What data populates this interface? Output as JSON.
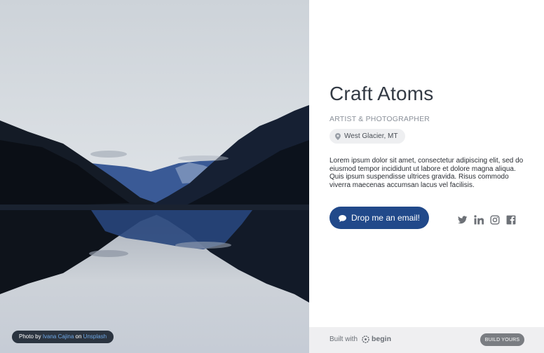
{
  "profile": {
    "name": "Craft Atoms",
    "role": "ARTIST & PHOTOGRAPHER",
    "location": "West Glacier, MT",
    "bio": "Lorem ipsum dolor sit amet, consectetur adipiscing elit, sed do eiusmod tempor incididunt ut labore et dolore magna aliqua. Quis ipsum suspendisse ultrices gravida. Risus commodo viverra maecenas accumsan lacus vel facilisis.",
    "email_button": "Drop me an email!"
  },
  "photo_credit": {
    "prefix": "Photo by",
    "author": "Ivana Cajina",
    "connector": "on",
    "site": "Unsplash"
  },
  "socials": [
    "twitter-icon",
    "linkedin-icon",
    "instagram-icon",
    "facebook-icon"
  ],
  "footer": {
    "built_with": "Built with",
    "brand": "begin",
    "cta": "BUILD YOURS"
  },
  "colors": {
    "accent": "#21498a",
    "text": "#333a44",
    "muted": "#8a9099",
    "footer_bg": "#efeff1"
  }
}
